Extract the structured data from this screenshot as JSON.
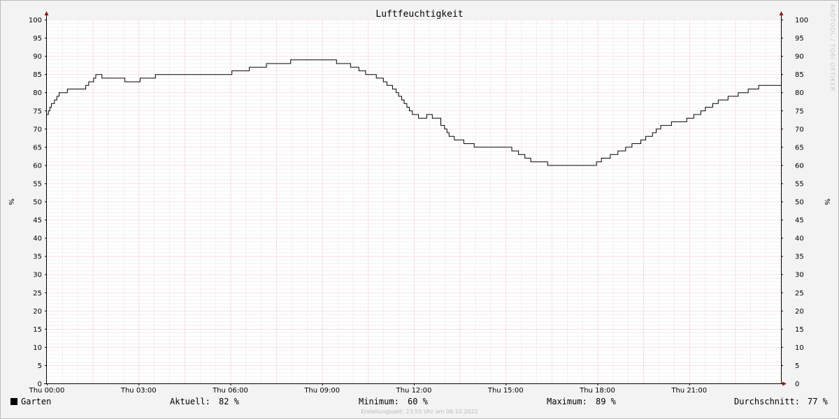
{
  "chart_data": {
    "type": "line",
    "title": "Luftfeuchtigkeit",
    "ylabel": "%",
    "ylim": [
      0,
      100
    ],
    "y_ticks": [
      0,
      5,
      10,
      15,
      20,
      25,
      30,
      35,
      40,
      45,
      50,
      55,
      60,
      65,
      70,
      75,
      80,
      85,
      90,
      95,
      100
    ],
    "xlim_hours": [
      0,
      24
    ],
    "x_ticks": [
      {
        "hour": 0,
        "label": "Thu 00:00"
      },
      {
        "hour": 3,
        "label": "Thu 03:00"
      },
      {
        "hour": 6,
        "label": "Thu 06:00"
      },
      {
        "hour": 9,
        "label": "Thu 09:00"
      },
      {
        "hour": 12,
        "label": "Thu 12:00"
      },
      {
        "hour": 15,
        "label": "Thu 15:00"
      },
      {
        "hour": 18,
        "label": "Thu 18:00"
      },
      {
        "hour": 21,
        "label": "Thu 21:00"
      }
    ],
    "grid": true,
    "series": [
      {
        "name": "Garten",
        "color": "#000000",
        "step": true,
        "x_hours": [
          0.0,
          0.05,
          0.1,
          0.15,
          0.25,
          0.33,
          0.4,
          0.67,
          1.27,
          1.37,
          1.53,
          1.6,
          1.8,
          1.87,
          2.55,
          3.05,
          3.55,
          6.05,
          6.62,
          7.18,
          7.97,
          8.5,
          9.47,
          9.55,
          9.93,
          10.2,
          10.42,
          10.57,
          10.77,
          10.92,
          11.0,
          11.12,
          11.22,
          11.3,
          11.42,
          11.5,
          11.6,
          11.68,
          11.77,
          11.85,
          11.95,
          12.05,
          12.15,
          12.25,
          12.42,
          12.55,
          12.6,
          12.72,
          12.88,
          12.95,
          13.0,
          13.08,
          13.15,
          13.32,
          13.63,
          13.97,
          14.27,
          15.2,
          15.42,
          15.63,
          15.82,
          16.37,
          17.97,
          18.13,
          18.42,
          18.67,
          18.92,
          19.13,
          19.42,
          19.58,
          19.8,
          19.92,
          20.07,
          20.25,
          20.42,
          20.63,
          20.92,
          21.15,
          21.38,
          21.53,
          21.77,
          21.95,
          22.27,
          22.6,
          22.93,
          23.27,
          23.57,
          24.0
        ],
        "values": [
          74,
          75,
          76,
          77,
          78,
          79,
          80,
          81,
          82,
          83,
          84,
          85,
          84,
          84,
          83,
          84,
          85,
          86,
          87,
          88,
          89,
          89,
          88,
          88,
          87,
          86,
          85,
          85,
          84,
          84,
          83,
          82,
          82,
          81,
          80,
          79,
          78,
          77,
          76,
          75,
          74,
          74,
          73,
          73,
          74,
          74,
          73,
          73,
          71,
          71,
          70,
          69,
          68,
          67,
          66,
          65,
          65,
          64,
          63,
          62,
          61,
          60,
          61,
          62,
          63,
          64,
          65,
          66,
          67,
          68,
          69,
          70,
          71,
          71,
          72,
          72,
          73,
          74,
          75,
          76,
          77,
          78,
          79,
          80,
          81,
          82,
          82,
          82
        ]
      }
    ]
  },
  "legend": {
    "series_name": "Garten",
    "current_label": "Aktuell:",
    "current_value": "82 %",
    "min_label": "Minimum:",
    "min_value": "60 %",
    "max_label": "Maximum:",
    "max_value": "89 %",
    "avg_label": "Durchschnitt:",
    "avg_value": "77 %"
  },
  "footer": "Erstellungszeit: 23:55 Uhr am 06.10.2022",
  "watermark": "RRDTOOL / TOBI OETIKER",
  "colors": {
    "background": "#f3f3f3",
    "plot_background": "#ffffff",
    "minor_grid": "#cccccc",
    "major_grid": "#e8a0a8",
    "axis_arrow": "#8b1a1a",
    "line": "#000000"
  }
}
